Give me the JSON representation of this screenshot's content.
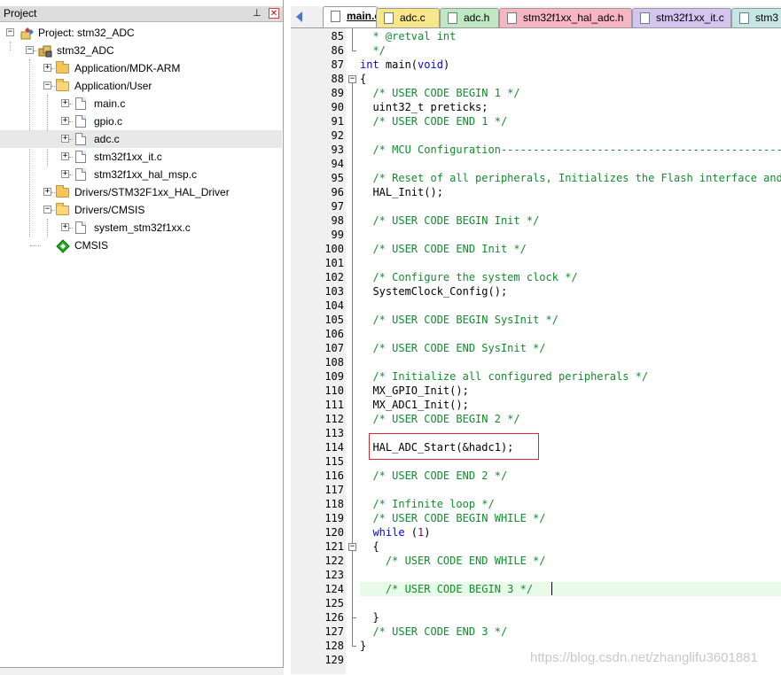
{
  "project_panel": {
    "title": "Project",
    "pin_icon": "pin-icon",
    "close_icon": "close-icon",
    "tree": [
      {
        "label": "Project: stm32_ADC",
        "icon": "project-icon",
        "level": 0,
        "expander": "−"
      },
      {
        "label": "stm32_ADC",
        "icon": "target-icon",
        "level": 1,
        "expander": "−"
      },
      {
        "label": "Application/MDK-ARM",
        "icon": "folder-icon",
        "level": 2,
        "expander": "+"
      },
      {
        "label": "Application/User",
        "icon": "folder-open-icon",
        "level": 2,
        "expander": "−"
      },
      {
        "label": "main.c",
        "icon": "file-icon",
        "level": 3,
        "expander": "+"
      },
      {
        "label": "gpio.c",
        "icon": "file-icon",
        "level": 3,
        "expander": "+"
      },
      {
        "label": "adc.c",
        "icon": "file-icon",
        "level": 3,
        "expander": "+",
        "selected": true
      },
      {
        "label": "stm32f1xx_it.c",
        "icon": "file-icon",
        "level": 3,
        "expander": "+"
      },
      {
        "label": "stm32f1xx_hal_msp.c",
        "icon": "file-icon",
        "level": 3,
        "expander": "+"
      },
      {
        "label": "Drivers/STM32F1xx_HAL_Driver",
        "icon": "folder-icon",
        "level": 2,
        "expander": "+"
      },
      {
        "label": "Drivers/CMSIS",
        "icon": "folder-open-icon",
        "level": 2,
        "expander": "−"
      },
      {
        "label": "system_stm32f1xx.c",
        "icon": "file-icon",
        "level": 3,
        "expander": "+"
      },
      {
        "label": "CMSIS",
        "icon": "cmsis-diamond-icon",
        "level": 2,
        "expander": ""
      }
    ]
  },
  "tabs": [
    {
      "label": "main.c*",
      "active": true,
      "color": "#ffffff"
    },
    {
      "label": "adc.c",
      "active": false,
      "color": "#f8e68a"
    },
    {
      "label": "adc.h",
      "active": false,
      "color": "#bfe8c3"
    },
    {
      "label": "stm32f1xx_hal_adc.h",
      "active": false,
      "color": "#f7b6c2"
    },
    {
      "label": "stm32f1xx_it.c",
      "active": false,
      "color": "#d4c4f0"
    },
    {
      "label": "stm3",
      "active": false,
      "color": "#c6e6e6"
    }
  ],
  "editor": {
    "lines": [
      {
        "n": "85",
        "code": [
          [
            "c",
            "  * @retval int"
          ]
        ]
      },
      {
        "n": "86",
        "code": [
          [
            "c",
            "  */"
          ]
        ]
      },
      {
        "n": "87",
        "code": [
          [
            "k",
            "int"
          ],
          [
            "p",
            " main("
          ],
          [
            "k",
            "void"
          ],
          [
            "p",
            ")"
          ]
        ]
      },
      {
        "n": "88",
        "code": [
          [
            "p",
            "{"
          ]
        ]
      },
      {
        "n": "89",
        "code": [
          [
            "c",
            "  /* USER CODE BEGIN 1 */"
          ]
        ]
      },
      {
        "n": "90",
        "code": [
          [
            "p",
            "  uint32_t preticks;"
          ]
        ]
      },
      {
        "n": "91",
        "code": [
          [
            "c",
            "  /* USER CODE END 1 */"
          ]
        ]
      },
      {
        "n": "92",
        "code": []
      },
      {
        "n": "93",
        "code": [
          [
            "c",
            "  /* MCU Configuration--------------------------------------------------------*/"
          ]
        ]
      },
      {
        "n": "94",
        "code": []
      },
      {
        "n": "95",
        "code": [
          [
            "c",
            "  /* Reset of all peripherals, Initializes the Flash interface and the Systick. */"
          ]
        ]
      },
      {
        "n": "96",
        "code": [
          [
            "p",
            "  HAL_Init();"
          ]
        ]
      },
      {
        "n": "97",
        "code": []
      },
      {
        "n": "98",
        "code": [
          [
            "c",
            "  /* USER CODE BEGIN Init */"
          ]
        ]
      },
      {
        "n": "99",
        "code": []
      },
      {
        "n": "100",
        "code": [
          [
            "c",
            "  /* USER CODE END Init */"
          ]
        ]
      },
      {
        "n": "101",
        "code": []
      },
      {
        "n": "102",
        "code": [
          [
            "c",
            "  /* Configure the system clock */"
          ]
        ]
      },
      {
        "n": "103",
        "code": [
          [
            "p",
            "  SystemClock_Config();"
          ]
        ]
      },
      {
        "n": "104",
        "code": []
      },
      {
        "n": "105",
        "code": [
          [
            "c",
            "  /* USER CODE BEGIN SysInit */"
          ]
        ]
      },
      {
        "n": "106",
        "code": []
      },
      {
        "n": "107",
        "code": [
          [
            "c",
            "  /* USER CODE END SysInit */"
          ]
        ]
      },
      {
        "n": "108",
        "code": []
      },
      {
        "n": "109",
        "code": [
          [
            "c",
            "  /* Initialize all configured peripherals */"
          ]
        ]
      },
      {
        "n": "110",
        "code": [
          [
            "p",
            "  MX_GPIO_Init();"
          ]
        ]
      },
      {
        "n": "111",
        "code": [
          [
            "p",
            "  MX_ADC1_Init();"
          ]
        ]
      },
      {
        "n": "112",
        "code": [
          [
            "c",
            "  /* USER CODE BEGIN 2 */"
          ]
        ]
      },
      {
        "n": "113",
        "code": []
      },
      {
        "n": "114",
        "code": [
          [
            "p",
            "  HAL_ADC_Start(&hadc1);"
          ]
        ]
      },
      {
        "n": "115",
        "code": []
      },
      {
        "n": "116",
        "code": [
          [
            "c",
            "  /* USER CODE END 2 */"
          ]
        ]
      },
      {
        "n": "117",
        "code": []
      },
      {
        "n": "118",
        "code": [
          [
            "c",
            "  /* Infinite loop */"
          ]
        ]
      },
      {
        "n": "119",
        "code": [
          [
            "c",
            "  /* USER CODE BEGIN WHILE */"
          ]
        ]
      },
      {
        "n": "120",
        "code": [
          [
            "k",
            "  while"
          ],
          [
            "p",
            " ("
          ],
          [
            "n",
            "1"
          ],
          [
            "p",
            ")"
          ]
        ]
      },
      {
        "n": "121",
        "code": [
          [
            "p",
            "  {"
          ]
        ]
      },
      {
        "n": "122",
        "code": [
          [
            "c",
            "    /* USER CODE END WHILE */"
          ]
        ]
      },
      {
        "n": "123",
        "code": []
      },
      {
        "n": "124",
        "code": [
          [
            "c",
            "    /* USER CODE BEGIN 3 */"
          ]
        ],
        "highlight": true
      },
      {
        "n": "125",
        "code": []
      },
      {
        "n": "126",
        "code": [
          [
            "p",
            "  }"
          ]
        ]
      },
      {
        "n": "127",
        "code": [
          [
            "c",
            "  /* USER CODE END 3 */"
          ]
        ]
      },
      {
        "n": "128",
        "code": [
          [
            "p",
            "}"
          ]
        ]
      },
      {
        "n": "129",
        "code": []
      }
    ],
    "watermark": "https://blog.csdn.net/zhanglifu3601881"
  }
}
